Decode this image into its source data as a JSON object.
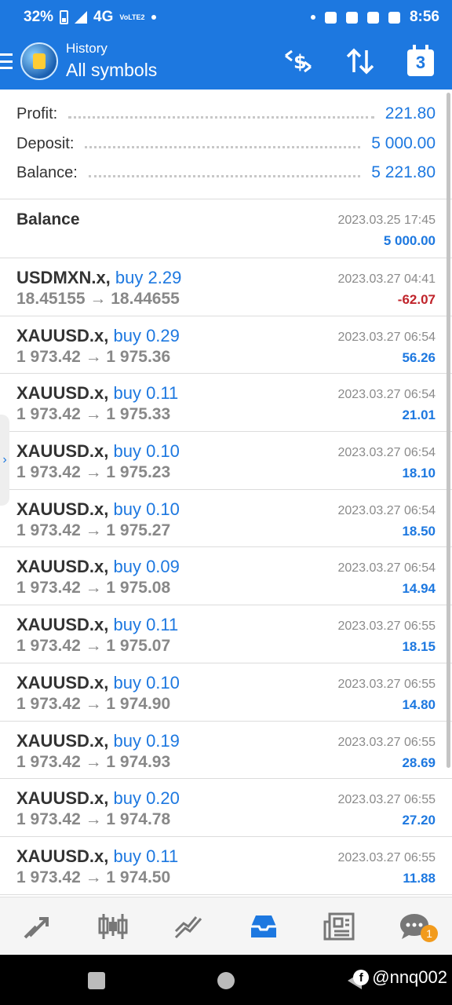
{
  "status_bar": {
    "battery": "32%",
    "network": "4G",
    "volte": "VoLTE2",
    "time": "8:56"
  },
  "app_bar": {
    "subtitle": "History",
    "title": "All symbols",
    "calendar_day": "3"
  },
  "summary": [
    {
      "label": "Profit:",
      "value": "221.80"
    },
    {
      "label": "Deposit:",
      "value": "5 000.00"
    },
    {
      "label": "Balance:",
      "value": "5 221.80"
    }
  ],
  "balance_row": {
    "label": "Balance",
    "date": "2023.03.25 17:45",
    "amount": "5 000.00"
  },
  "rows": [
    {
      "symbol": "USDMXN.x,",
      "direction": "buy 2.29",
      "prices": "18.45155 → 18.44655",
      "date": "2023.03.27 04:41",
      "profit": "-62.07",
      "negative": true
    },
    {
      "symbol": "XAUUSD.x,",
      "direction": "buy 0.29",
      "prices": "1 973.42 → 1 975.36",
      "date": "2023.03.27 06:54",
      "profit": "56.26",
      "negative": false
    },
    {
      "symbol": "XAUUSD.x,",
      "direction": "buy 0.11",
      "prices": "1 973.42 → 1 975.33",
      "date": "2023.03.27 06:54",
      "profit": "21.01",
      "negative": false
    },
    {
      "symbol": "XAUUSD.x,",
      "direction": "buy 0.10",
      "prices": "1 973.42 → 1 975.23",
      "date": "2023.03.27 06:54",
      "profit": "18.10",
      "negative": false
    },
    {
      "symbol": "XAUUSD.x,",
      "direction": "buy 0.10",
      "prices": "1 973.42 → 1 975.27",
      "date": "2023.03.27 06:54",
      "profit": "18.50",
      "negative": false
    },
    {
      "symbol": "XAUUSD.x,",
      "direction": "buy 0.09",
      "prices": "1 973.42 → 1 975.08",
      "date": "2023.03.27 06:54",
      "profit": "14.94",
      "negative": false
    },
    {
      "symbol": "XAUUSD.x,",
      "direction": "buy 0.11",
      "prices": "1 973.42 → 1 975.07",
      "date": "2023.03.27 06:55",
      "profit": "18.15",
      "negative": false
    },
    {
      "symbol": "XAUUSD.x,",
      "direction": "buy 0.10",
      "prices": "1 973.42 → 1 974.90",
      "date": "2023.03.27 06:55",
      "profit": "14.80",
      "negative": false
    },
    {
      "symbol": "XAUUSD.x,",
      "direction": "buy 0.19",
      "prices": "1 973.42 → 1 974.93",
      "date": "2023.03.27 06:55",
      "profit": "28.69",
      "negative": false
    },
    {
      "symbol": "XAUUSD.x,",
      "direction": "buy 0.20",
      "prices": "1 973.42 → 1 974.78",
      "date": "2023.03.27 06:55",
      "profit": "27.20",
      "negative": false
    },
    {
      "symbol": "XAUUSD.x,",
      "direction": "buy 0.11",
      "prices": "1 973.42 → 1 974.50",
      "date": "2023.03.27 06:55",
      "profit": "11.88",
      "negative": false
    }
  ],
  "bottom_nav": [
    {
      "icon": "trade-icon",
      "active": false
    },
    {
      "icon": "candlestick-chart-icon",
      "active": false
    },
    {
      "icon": "line-chart-icon",
      "active": false
    },
    {
      "icon": "history-inbox-icon",
      "active": true
    },
    {
      "icon": "news-icon",
      "active": false
    },
    {
      "icon": "chat-icon",
      "active": false,
      "badge": "1"
    }
  ],
  "watermark": "@nnq002",
  "colors": {
    "accent": "#1d78e0",
    "negative": "#c0242b",
    "badge": "#f29b1d"
  }
}
